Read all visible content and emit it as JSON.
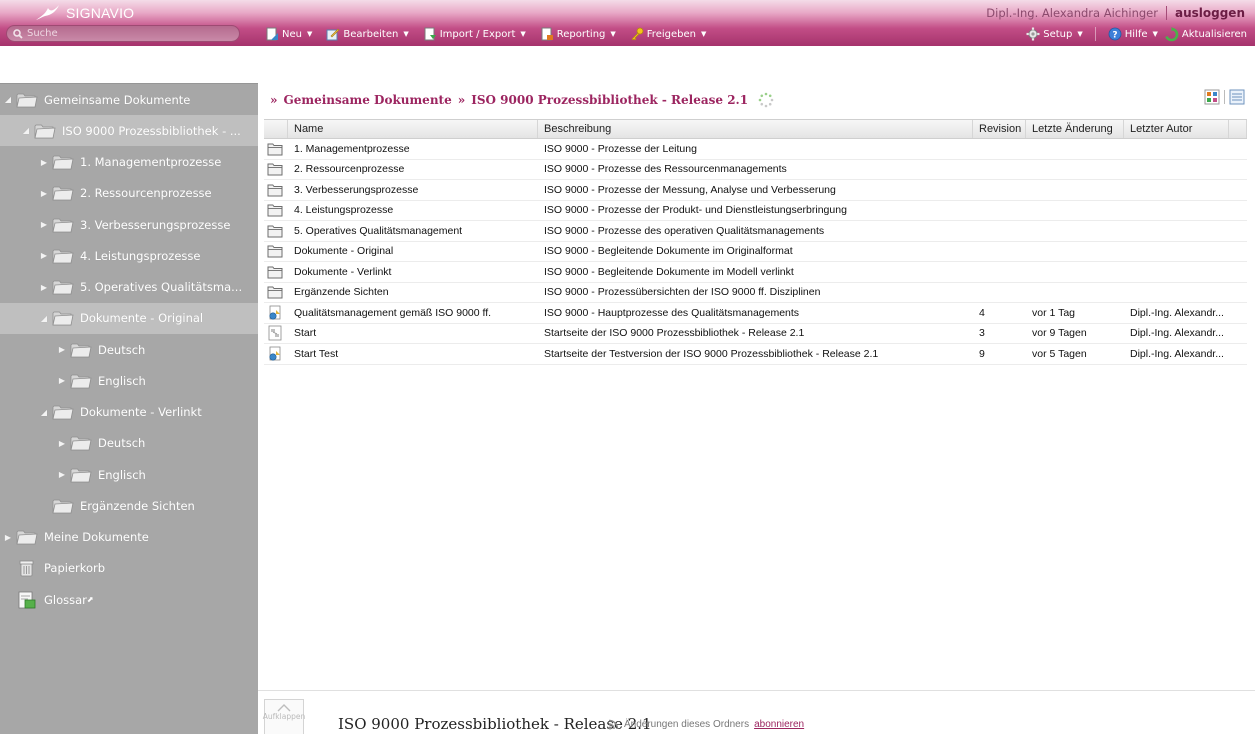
{
  "app": {
    "brand": "SIGNAVIO"
  },
  "user": {
    "name": "Dipl.-Ing. Alexandra Aichinger",
    "logout_label": "ausloggen"
  },
  "search": {
    "placeholder": "Suche"
  },
  "toolbar": {
    "left": [
      {
        "label": "Neu",
        "icon": "new-doc-icon"
      },
      {
        "label": "Bearbeiten",
        "icon": "edit-icon"
      },
      {
        "label": "Import / Export",
        "icon": "import-export-icon"
      },
      {
        "label": "Reporting",
        "icon": "reporting-icon"
      },
      {
        "label": "Freigeben",
        "icon": "key-icon"
      }
    ],
    "right": [
      {
        "label": "Setup",
        "icon": "gear-icon",
        "has_menu": true
      },
      {
        "label": "Hilfe",
        "icon": "help-icon",
        "has_menu": true
      },
      {
        "label": "Aktualisieren",
        "icon": "refresh-icon",
        "has_menu": false
      }
    ]
  },
  "sidebar": {
    "items": [
      {
        "label": "Gemeinsame Dokumente",
        "level": 0,
        "arrow": "expanded",
        "icon": "folder-icon",
        "selected": false
      },
      {
        "label": "ISO 9000 Prozessbibliothek - ...",
        "level": 1,
        "arrow": "expanded",
        "icon": "folder-icon",
        "selected": true
      },
      {
        "label": "1. Managementprozesse",
        "level": 2,
        "arrow": "collapsed",
        "icon": "folder-icon",
        "selected": false
      },
      {
        "label": "2. Ressourcenprozesse",
        "level": 2,
        "arrow": "collapsed",
        "icon": "folder-icon",
        "selected": false
      },
      {
        "label": "3. Verbesserungsprozesse",
        "level": 2,
        "arrow": "collapsed",
        "icon": "folder-icon",
        "selected": false
      },
      {
        "label": "4. Leistungsprozesse",
        "level": 2,
        "arrow": "collapsed",
        "icon": "folder-icon",
        "selected": false
      },
      {
        "label": "5. Operatives Qualitätsma...",
        "level": 2,
        "arrow": "collapsed",
        "icon": "folder-icon",
        "selected": false
      },
      {
        "label": "Dokumente - Original",
        "level": 2,
        "arrow": "expanded",
        "icon": "folder-icon",
        "selected": true
      },
      {
        "label": "Deutsch",
        "level": 3,
        "arrow": "collapsed",
        "icon": "folder-icon",
        "selected": false
      },
      {
        "label": "Englisch",
        "level": 3,
        "arrow": "collapsed",
        "icon": "folder-icon",
        "selected": false
      },
      {
        "label": "Dokumente - Verlinkt",
        "level": 2,
        "arrow": "expanded",
        "icon": "folder-icon",
        "selected": false
      },
      {
        "label": "Deutsch",
        "level": 3,
        "arrow": "collapsed",
        "icon": "folder-icon",
        "selected": false
      },
      {
        "label": "Englisch",
        "level": 3,
        "arrow": "collapsed",
        "icon": "folder-icon",
        "selected": false
      },
      {
        "label": "Ergänzende Sichten",
        "level": 2,
        "arrow": "none",
        "icon": "folder-icon",
        "selected": false
      },
      {
        "label": "Meine Dokumente",
        "level": 0,
        "arrow": "collapsed",
        "icon": "folder-icon",
        "selected": false
      },
      {
        "label": "Papierkorb",
        "level": 0,
        "arrow": "none",
        "icon": "trash-icon",
        "selected": false
      },
      {
        "label": "Glossar",
        "level": 0,
        "arrow": "none",
        "icon": "glossary-icon",
        "selected": false,
        "external": true
      }
    ]
  },
  "breadcrumb": {
    "items": [
      "Gemeinsame Dokumente",
      "ISO 9000 Prozessbibliothek - Release 2.1"
    ]
  },
  "grid": {
    "columns": [
      "Name",
      "Beschreibung",
      "Revision",
      "Letzte Änderung",
      "Letzter Autor"
    ],
    "rows": [
      {
        "icon": "folder-icon",
        "name": "1. Managementprozesse",
        "desc": "ISO 9000 - Prozesse der Leitung",
        "rev": "",
        "date": "",
        "author": ""
      },
      {
        "icon": "folder-icon",
        "name": "2. Ressourcenprozesse",
        "desc": "ISO 9000 - Prozesse des Ressourcenmanagements",
        "rev": "",
        "date": "",
        "author": ""
      },
      {
        "icon": "folder-icon",
        "name": "3. Verbesserungsprozesse",
        "desc": "ISO 9000 - Prozesse der Messung, Analyse und Verbesserung",
        "rev": "",
        "date": "",
        "author": ""
      },
      {
        "icon": "folder-icon",
        "name": "4. Leistungsprozesse",
        "desc": "ISO 9000 - Prozesse der Produkt- und Dienstleistungserbringung",
        "rev": "",
        "date": "",
        "author": ""
      },
      {
        "icon": "folder-icon",
        "name": "5. Operatives Qualitätsmanagement",
        "desc": "ISO 9000 - Prozesse des operativen Qualitätsmanagements",
        "rev": "",
        "date": "",
        "author": ""
      },
      {
        "icon": "folder-icon",
        "name": "Dokumente - Original",
        "desc": "ISO 9000 - Begleitende Dokumente im Originalformat",
        "rev": "",
        "date": "",
        "author": ""
      },
      {
        "icon": "folder-icon",
        "name": "Dokumente - Verlinkt",
        "desc": "ISO 9000 - Begleitende Dokumente im Modell verlinkt",
        "rev": "",
        "date": "",
        "author": ""
      },
      {
        "icon": "folder-icon",
        "name": "Ergänzende Sichten",
        "desc": "ISO 9000 - Prozessübersichten der ISO 9000 ff. Disziplinen",
        "rev": "",
        "date": "",
        "author": ""
      },
      {
        "icon": "model-icon",
        "name": "Qualitätsmanagement gemäß ISO 9000 ff.",
        "desc": "ISO 9000 - Hauptprozesse des Qualitätsmanagements",
        "rev": "4",
        "date": "vor 1 Tag",
        "author": "Dipl.-Ing. Alexandr..."
      },
      {
        "icon": "diagram-icon",
        "name": "Start",
        "desc": "Startseite der ISO 9000 Prozessbibliothek - Release 2.1",
        "rev": "3",
        "date": "vor 9 Tagen",
        "author": "Dipl.-Ing. Alexandr..."
      },
      {
        "icon": "model-icon",
        "name": "Start Test",
        "desc": "Startseite der Testversion der ISO 9000 Prozessbibliothek - Release 2.1",
        "rev": "9",
        "date": "vor 5 Tagen",
        "author": "Dipl.-Ing. Alexandr..."
      }
    ]
  },
  "bottom": {
    "expand_label": "Aufklappen",
    "title": "ISO 9000 Prozessbibliothek - Release 2.1",
    "subscribe_text": "Änderungen dieses Ordners",
    "subscribe_link": "abonnieren"
  }
}
